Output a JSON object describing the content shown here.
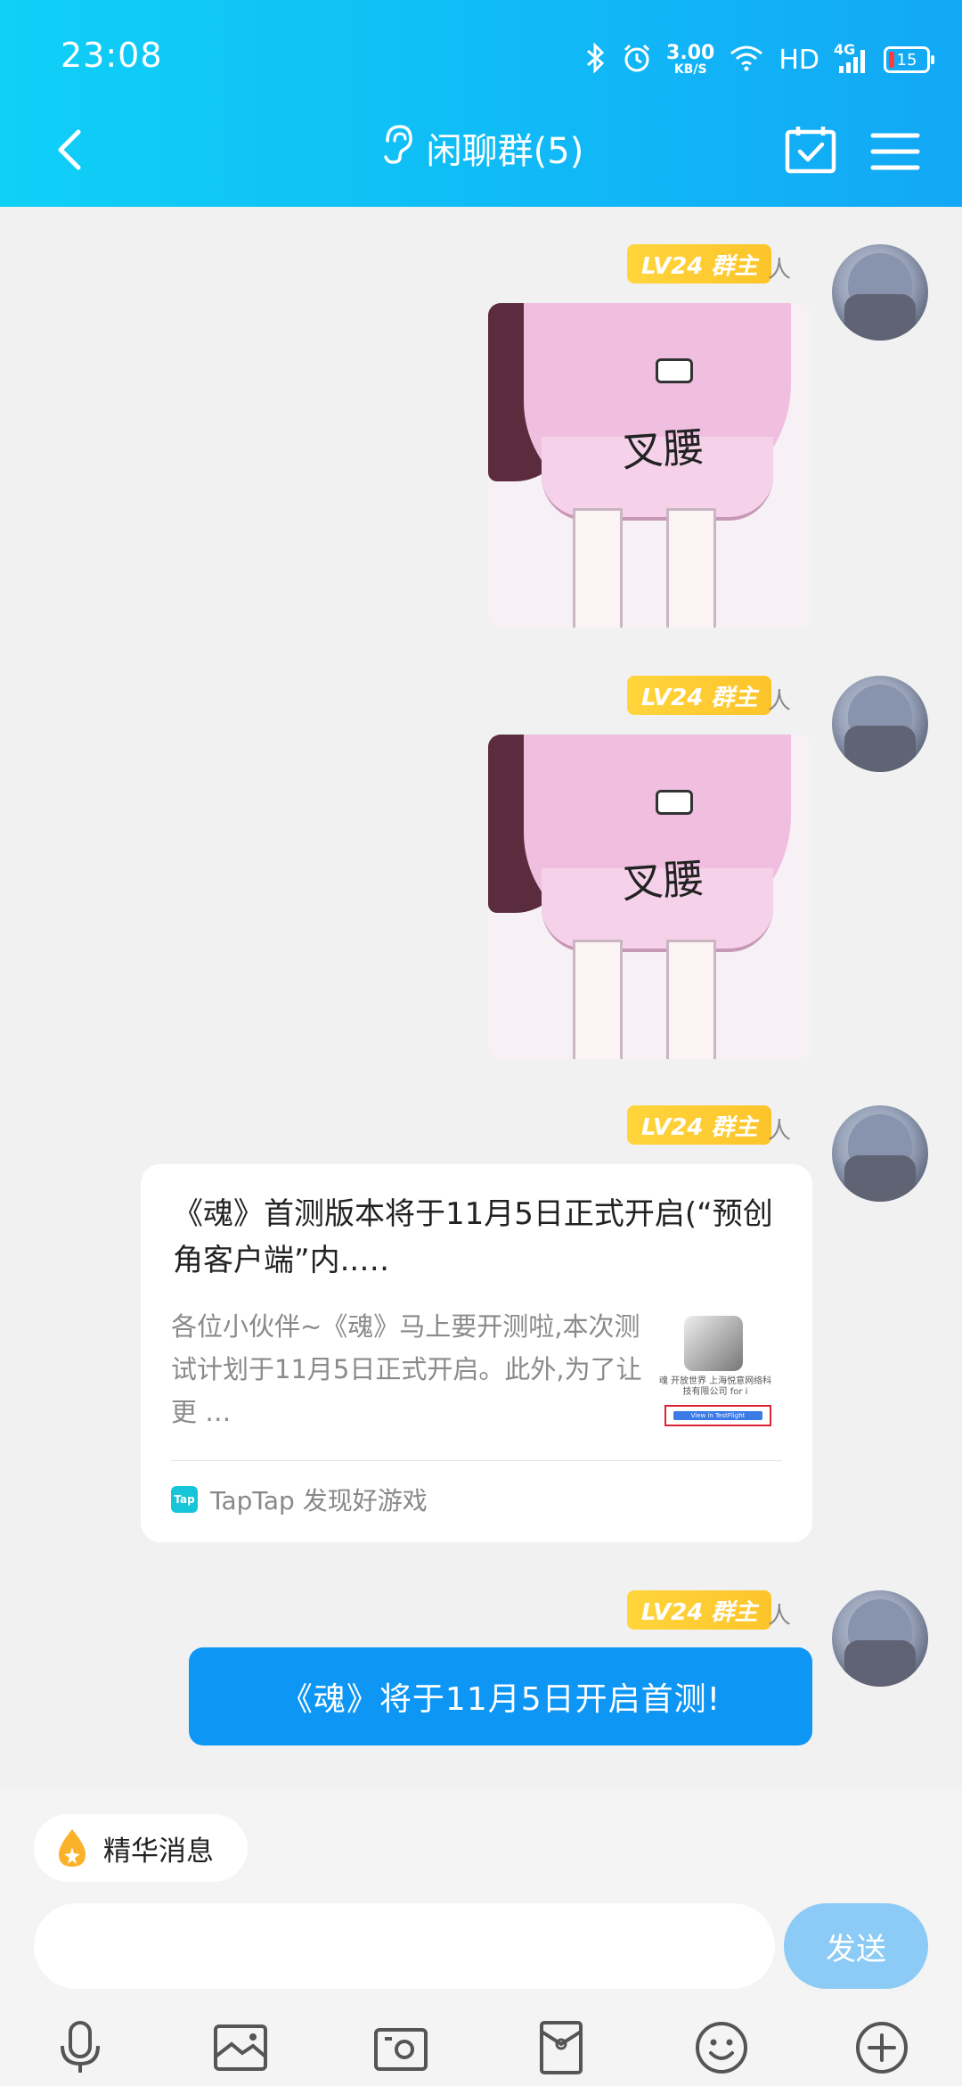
{
  "status_bar": {
    "time": "23:08",
    "net_speed": "3.00",
    "net_speed_unit": "KB/S",
    "hd": "HD",
    "signal": "4G",
    "battery": "15",
    "icons": [
      "bluetooth-icon",
      "alarm-icon",
      "wifi-icon",
      "signal-icon",
      "battery-icon"
    ]
  },
  "header": {
    "title": "闲聊群(5)",
    "icons": [
      "back-icon",
      "ear-icon",
      "calendar-check-icon",
      "menu-icon"
    ]
  },
  "messages": [
    {
      "type": "sticker",
      "badge": "LV24 群主",
      "sender_suffix": "人",
      "sticker_text": "叉腰"
    },
    {
      "type": "sticker",
      "badge": "LV24 群主",
      "sender_suffix": "人",
      "sticker_text": "叉腰"
    },
    {
      "type": "share_card",
      "badge": "LV24 群主",
      "sender_suffix": "人",
      "title": "《魂》首测版本将于11月5日正式开启(“预创角客户端”内..…",
      "description": "各位小伙伴~《魂》马上要开测啦,本次测试计划于11月5日正式开启。此外,为了让更 …",
      "thumb_text": "魂 开放世界 上海悦意网络科技有限公司 for i",
      "thumb_button": "View in TestFlight",
      "source_icon": "Tap",
      "source": "TapTap 发现好游戏"
    },
    {
      "type": "text",
      "badge": "LV24 群主",
      "sender_suffix": "人",
      "text": "《魂》将于11月5日开启首测!"
    }
  ],
  "composer": {
    "essence_label": "精华消息",
    "input_value": "",
    "send_label": "发送"
  },
  "toolbar": {
    "items": [
      "microphone-icon",
      "image-icon",
      "camera-icon",
      "red-packet-icon",
      "emoji-icon",
      "plus-icon"
    ]
  },
  "colors": {
    "header_gradient_start": "#0fd0f7",
    "header_gradient_end": "#12a8f5",
    "badge": "#fcc42a",
    "bubble_blue": "#0d96f4",
    "send_button": "#8ccbf6"
  }
}
